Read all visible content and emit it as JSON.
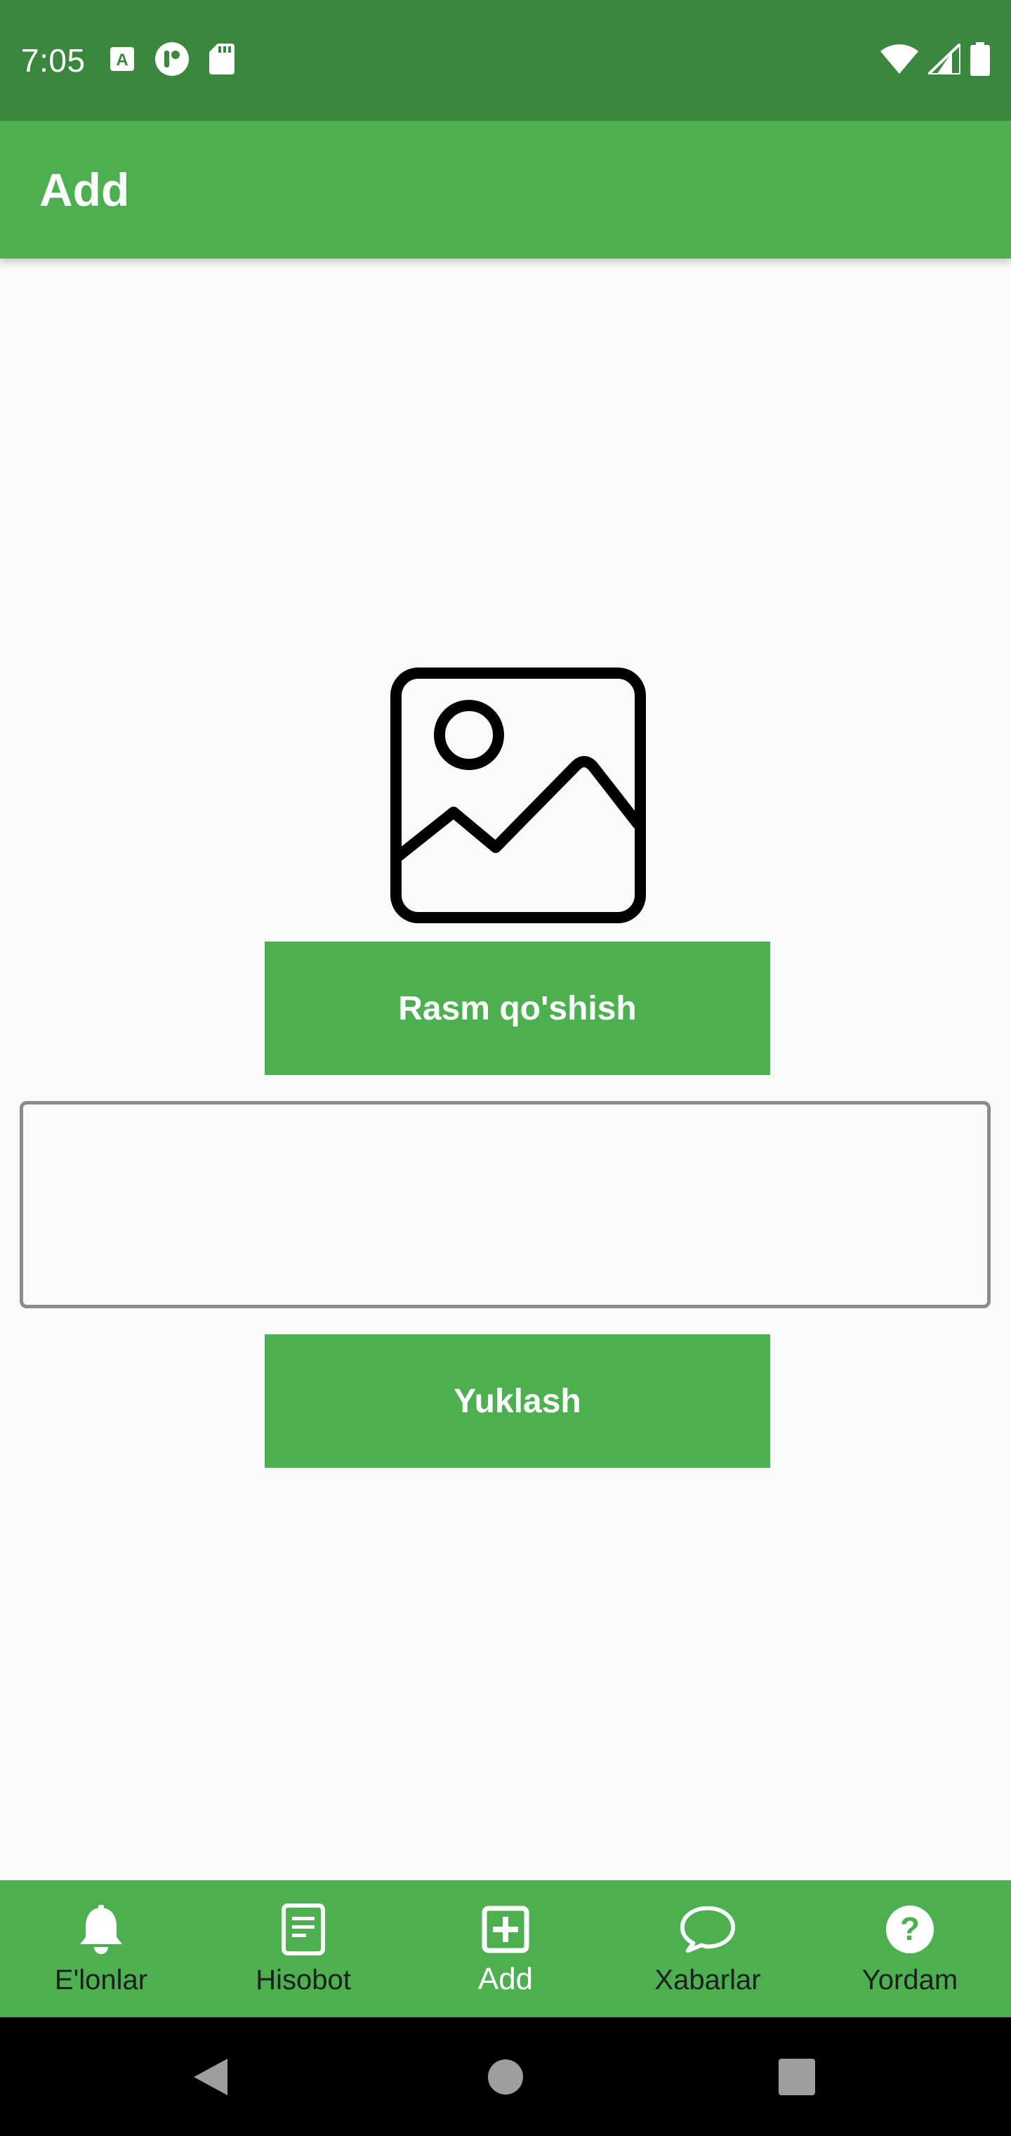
{
  "status_bar": {
    "time": "7:05",
    "left_icons": [
      "font-a-icon",
      "media-player-icon",
      "sd-card-icon"
    ],
    "right_icons": [
      "wifi-icon",
      "signal-icon",
      "battery-icon"
    ]
  },
  "app_bar": {
    "title": "Add"
  },
  "main": {
    "image_icon": "image-placeholder-icon",
    "add_image_button": "Rasm qo'shish",
    "text_input": {
      "value": "",
      "placeholder": ""
    },
    "upload_button": "Yuklash"
  },
  "bottom_nav": {
    "items": [
      {
        "label": "E'lonlar",
        "icon": "bell-icon",
        "active": false
      },
      {
        "label": "Hisobot",
        "icon": "document-icon",
        "active": false
      },
      {
        "label": "Add",
        "icon": "add-box-icon",
        "active": true
      },
      {
        "label": "Xabarlar",
        "icon": "chat-bubble-icon",
        "active": false
      },
      {
        "label": "Yordam",
        "icon": "help-icon",
        "active": false
      }
    ]
  },
  "system_nav": {
    "icons": [
      "back-icon",
      "home-icon",
      "recents-icon"
    ]
  },
  "colors": {
    "status_bar": "#3b873e",
    "primary": "#4caf50",
    "background": "#fafafa",
    "nav_label": "#1f1f1f",
    "active_label": "#ffffff"
  }
}
